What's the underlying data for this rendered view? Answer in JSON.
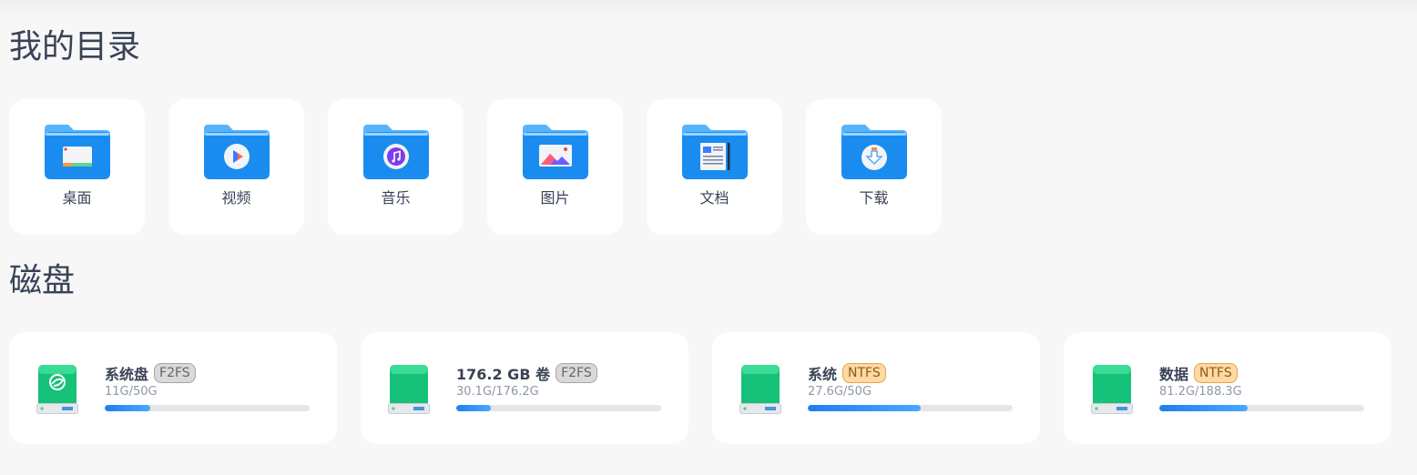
{
  "directories": {
    "title": "我的目录",
    "items": [
      {
        "label": "桌面",
        "icon": "desktop-folder-icon"
      },
      {
        "label": "视频",
        "icon": "video-folder-icon"
      },
      {
        "label": "音乐",
        "icon": "music-folder-icon"
      },
      {
        "label": "图片",
        "icon": "picture-folder-icon"
      },
      {
        "label": "文档",
        "icon": "document-folder-icon"
      },
      {
        "label": "下载",
        "icon": "download-folder-icon"
      }
    ]
  },
  "disks": {
    "title": "磁盘",
    "items": [
      {
        "name": "系统盘",
        "fs": "F2FS",
        "usage": "11G/50G",
        "used_fraction": 0.22,
        "badge_color": "#d9d9d9",
        "icon": "system-disk-icon"
      },
      {
        "name": "176.2 GB 卷",
        "fs": "F2FS",
        "usage": "30.1G/176.2G",
        "used_fraction": 0.17,
        "badge_color": "#d9d9d9",
        "icon": "disk-icon"
      },
      {
        "name": "系统",
        "fs": "NTFS",
        "usage": "27.6G/50G",
        "used_fraction": 0.55,
        "badge_color": "#ffd9a3",
        "icon": "disk-icon"
      },
      {
        "name": "数据",
        "fs": "NTFS",
        "usage": "81.2G/188.3G",
        "used_fraction": 0.43,
        "badge_color": "#ffd9a3",
        "icon": "disk-icon"
      }
    ]
  },
  "colors": {
    "accent": "#1f7ef0",
    "disk_green": "#16c17a",
    "folder_blue": "#1a8cf0"
  }
}
